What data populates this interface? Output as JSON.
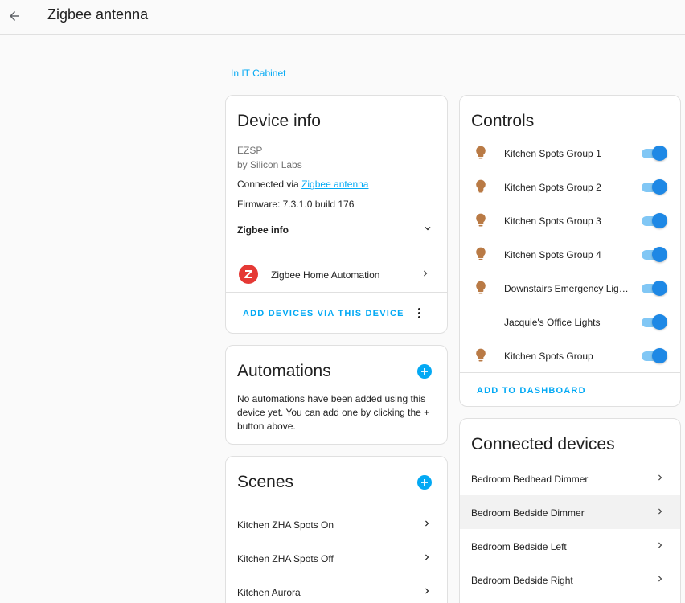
{
  "header": {
    "title": "Zigbee antenna"
  },
  "area_link": "In IT Cabinet",
  "device_info": {
    "title": "Device info",
    "model": "EZSP",
    "manufacturer": "by Silicon Labs",
    "connected_via_prefix": "Connected via ",
    "connected_via_link": "Zigbee antenna",
    "firmware": "Firmware: 7.3.1.0 build 176",
    "zigbee_info_label": "Zigbee info",
    "integration_label": "Zigbee Home Automation",
    "add_devices_label": "ADD DEVICES VIA THIS DEVICE"
  },
  "automations": {
    "title": "Automations",
    "empty_text": "No automations have been added using this device yet. You can add one by clicking the + button above."
  },
  "scenes": {
    "title": "Scenes",
    "items": [
      {
        "label": "Kitchen ZHA Spots On"
      },
      {
        "label": "Kitchen ZHA Spots Off"
      },
      {
        "label": "Kitchen Aurora"
      }
    ]
  },
  "controls": {
    "title": "Controls",
    "items": [
      {
        "label": "Kitchen Spots Group 1",
        "icon": "bulb-icon",
        "on": true
      },
      {
        "label": "Kitchen Spots Group 2",
        "icon": "bulb-icon",
        "on": true
      },
      {
        "label": "Kitchen Spots Group 3",
        "icon": "bulb-icon",
        "on": true
      },
      {
        "label": "Kitchen Spots Group 4",
        "icon": "bulb-icon",
        "on": true
      },
      {
        "label": "Downstairs Emergency Lig…",
        "icon": "bulb-icon",
        "on": true
      },
      {
        "label": "Jacquie's Office Lights",
        "icon": "none",
        "on": true
      },
      {
        "label": "Kitchen Spots Group",
        "icon": "bulb-icon",
        "on": true
      }
    ],
    "add_to_dashboard_label": "ADD TO DASHBOARD"
  },
  "connected_devices": {
    "title": "Connected devices",
    "items": [
      {
        "label": "Bedroom Bedhead Dimmer"
      },
      {
        "label": "Bedroom Bedside Dimmer"
      },
      {
        "label": "Bedroom Bedside Left"
      },
      {
        "label": "Bedroom Bedside Right"
      }
    ]
  },
  "colors": {
    "accent": "#03a9f4",
    "toggle_on": "#1e88e5",
    "bulb": "#b97a45",
    "zha_logo": "#e53935"
  }
}
